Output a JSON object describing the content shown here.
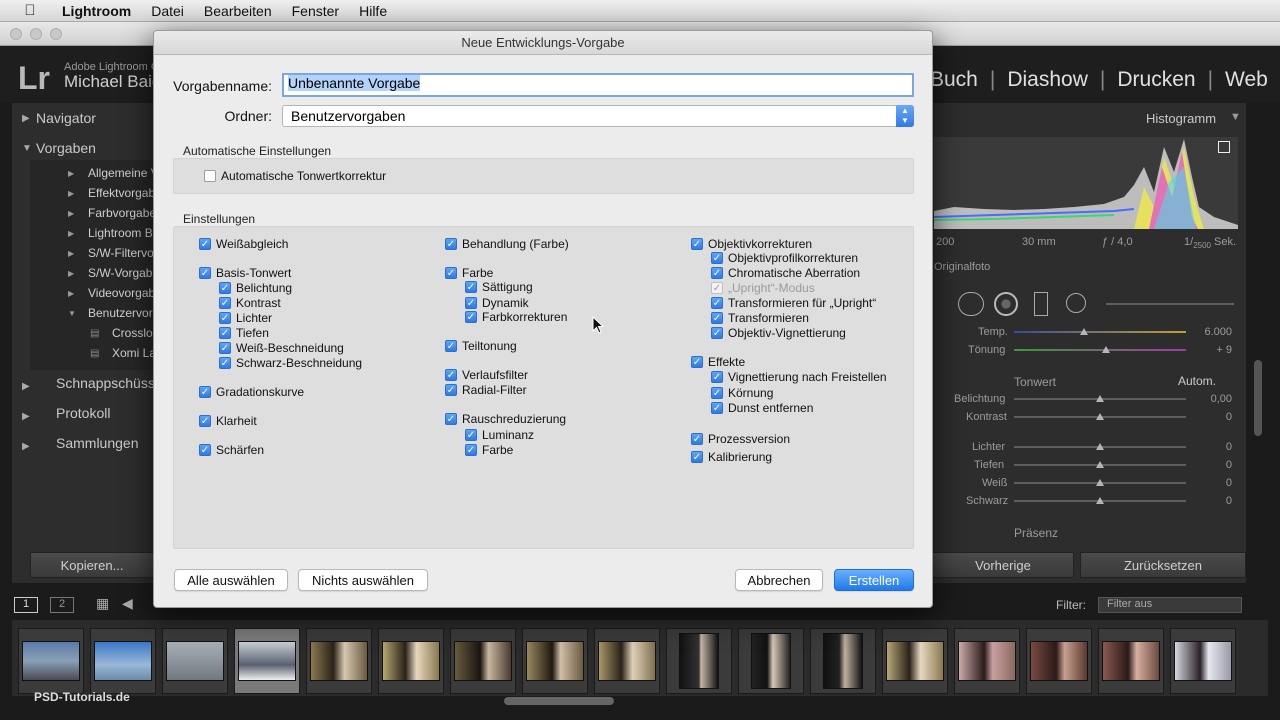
{
  "menubar": {
    "apple_icon": "apple-icon",
    "app": "Lightroom",
    "items": [
      "Datei",
      "Bearbeiten",
      "Fenster",
      "Hilfe"
    ]
  },
  "lr": {
    "logo": "Lr",
    "product_small": "Adobe Lightroom C",
    "user_name": "Michael Baie",
    "modules": [
      "Buch",
      "Diashow",
      "Drucken",
      "Web"
    ]
  },
  "left_panel": {
    "sections": [
      "Navigator",
      "Vorgaben",
      "Schnappschüsse",
      "Protokoll",
      "Sammlungen"
    ],
    "preset_folders": [
      "Allgemeine V",
      "Effektvorgab",
      "Farbvorgabe",
      "Lightroom B",
      "S/W-Filtervor",
      "S/W-Vorgabe",
      "Videovorgab",
      "Benutzervorg"
    ],
    "user_presets": [
      "Crossloo",
      "Xomi La"
    ],
    "copy_button": "Kopieren..."
  },
  "right_panel": {
    "histogram_label": "Histogramm",
    "exif": {
      "iso": "200",
      "focal": "30 mm",
      "aperture": "ƒ / 4,0",
      "shutter_num": "1/",
      "shutter_den": "2500",
      "shutter_unit": "Sek."
    },
    "originalfoto": "Originalfoto",
    "temp_label": "Temp.",
    "temp_value": "6.000",
    "tint_label": "Tönung",
    "tint_value": "+ 9",
    "tonwert_label": "Tonwert",
    "auto_label": "Autom.",
    "sliders": [
      {
        "label": "Belichtung",
        "value": "0,00"
      },
      {
        "label": "Kontrast",
        "value": "0"
      },
      {
        "label": "Lichter",
        "value": "0"
      },
      {
        "label": "Tiefen",
        "value": "0"
      },
      {
        "label": "Weiß",
        "value": "0"
      },
      {
        "label": "Schwarz",
        "value": "0"
      }
    ],
    "presence_label": "Präsenz",
    "prev_button": "Vorherige",
    "reset_button": "Zurücksetzen"
  },
  "filmbar": {
    "page1": "1",
    "page2": "2",
    "filter_label": "Filter:",
    "filter_value": "Filter aus"
  },
  "watermark": "PSD-Tutorials.de",
  "dialog": {
    "title": "Neue Entwicklungs-Vorgabe",
    "name_label": "Vorgabenname:",
    "name_value": "Unbenannte Vorgabe",
    "folder_label": "Ordner:",
    "folder_value": "Benutzervorgaben",
    "auto_section": "Automatische Einstellungen",
    "auto_tone": "Automatische Tonwertkorrektur",
    "settings_section": "Einstellungen",
    "col1": [
      "Weißabgleich",
      "Basis-Tonwert",
      "Belichtung",
      "Kontrast",
      "Lichter",
      "Tiefen",
      "Weiß-Beschneidung",
      "Schwarz-Beschneidung",
      "Gradationskurve",
      "Klarheit",
      "Schärfen"
    ],
    "col2": [
      "Behandlung (Farbe)",
      "Farbe",
      "Sättigung",
      "Dynamik",
      "Farbkorrekturen",
      "Teiltonung",
      "Verlaufsfilter",
      "Radial-Filter",
      "Rauschreduzierung",
      "Luminanz",
      "Farbe"
    ],
    "col3": [
      "Objektivkorrekturen",
      "Objektivprofilkorrekturen",
      "Chromatische Aberration",
      "„Upright“-Modus",
      "Transformieren für „Upright“",
      "Transformieren",
      "Objektiv-Vignettierung",
      "Effekte",
      "Vignettierung nach Freistellen",
      "Körnung",
      "Dunst entfernen",
      "Prozessversion",
      "Kalibrierung"
    ],
    "select_all": "Alle auswählen",
    "select_none": "Nichts auswählen",
    "cancel": "Abbrechen",
    "create": "Erstellen"
  }
}
